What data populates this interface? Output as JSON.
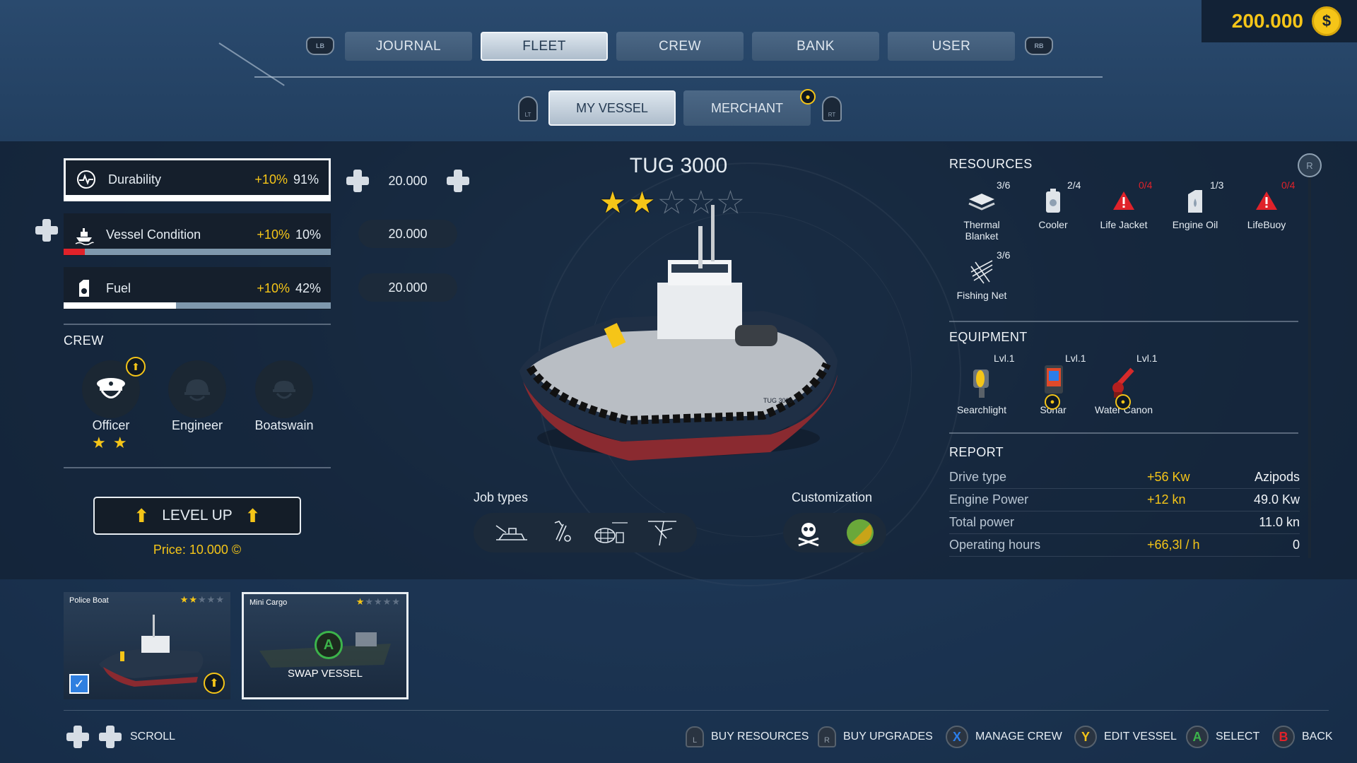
{
  "currency": {
    "value": "200.000",
    "symbol": "$"
  },
  "tabs": [
    {
      "label": "JOURNAL",
      "active": false
    },
    {
      "label": "FLEET",
      "active": true
    },
    {
      "label": "CREW",
      "active": false
    },
    {
      "label": "BANK",
      "active": false
    },
    {
      "label": "USER",
      "active": false
    }
  ],
  "bumpers": {
    "left": "LB",
    "right": "RB"
  },
  "subtabs": [
    {
      "label": "MY VESSEL",
      "active": true
    },
    {
      "label": "MERCHANT",
      "active": false,
      "notification": true
    }
  ],
  "triggers": {
    "left": "LT",
    "right": "RT"
  },
  "stats": [
    {
      "label": "Durability",
      "bonus": "+10%",
      "value": "91%",
      "level": 1.0,
      "cost": "20.000",
      "icon": "durability-icon"
    },
    {
      "label": "Vessel Condition",
      "bonus": "+10%",
      "value": "10%",
      "level": 0.08,
      "cost": "20.000",
      "icon": "vessel-condition-icon"
    },
    {
      "label": "Fuel",
      "bonus": "+10%",
      "value": "42%",
      "level": 0.42,
      "cost": "20.000",
      "icon": "fuel-icon"
    }
  ],
  "crew": {
    "title": "CREW",
    "members": [
      {
        "name": "Officer",
        "stars": "★ ★",
        "upgrade": true
      },
      {
        "name": "Engineer"
      },
      {
        "name": "Boatswain"
      }
    ],
    "level_up_label": "LEVEL UP",
    "price": "Price: 10.000",
    "price_icon": "coin-icon"
  },
  "vessel": {
    "name": "TUG 3000",
    "stars_total": 5,
    "stars_filled": 2,
    "hull_label": "TUG 3000",
    "job_types_label": "Job types",
    "job_types": [
      "towing-icon",
      "diving-icon",
      "fishing-net-icon",
      "rescue-icon"
    ],
    "customization_label": "Customization"
  },
  "resources": {
    "title": "RESOURCES",
    "items": [
      {
        "name": "Thermal Blanket",
        "count": "3/6",
        "alert": false
      },
      {
        "name": "Cooler",
        "count": "2/4",
        "alert": false
      },
      {
        "name": "Life Jacket",
        "count": "0/4",
        "alert": true
      },
      {
        "name": "Engine Oil",
        "count": "1/3",
        "alert": false
      },
      {
        "name": "LifeBuoy",
        "count": "0/4",
        "alert": true
      },
      {
        "name": "Fishing Net",
        "count": "3/6",
        "alert": false
      }
    ]
  },
  "equipment": {
    "title": "EQUIPMENT",
    "items": [
      {
        "name": "Searchlight",
        "level": "Lvl.1"
      },
      {
        "name": "Sonar",
        "level": "Lvl.1"
      },
      {
        "name": "Water Canon",
        "level": "Lvl.1"
      }
    ]
  },
  "report": {
    "title": "REPORT",
    "rows": [
      {
        "label": "Drive type",
        "bonus": "+56 Kw",
        "value": "Azipods"
      },
      {
        "label": "Engine Power",
        "bonus": "+12 kn",
        "value": "49.0 Kw"
      },
      {
        "label": "Total power",
        "bonus": "",
        "value": "11.0 kn"
      },
      {
        "label": "Operating hours",
        "bonus": "+66,3l / h",
        "value": "0"
      }
    ]
  },
  "scroll_button": "R",
  "vessel_cards": [
    {
      "name": "Police Boat",
      "stars_filled": 2,
      "stars_total": 5,
      "selected": false,
      "checked": true
    },
    {
      "name": "Mini Cargo",
      "stars_filled": 1,
      "stars_total": 5,
      "selected": true,
      "action_button": "A",
      "action_label": "SWAP VESSEL"
    }
  ],
  "hints": {
    "scroll": "SCROLL",
    "buy_resources": {
      "button": "L",
      "label": "BUY RESOURCES"
    },
    "buy_upgrades": {
      "button": "R",
      "label": "BUY UPGRADES"
    },
    "manage_crew": {
      "button": "X",
      "label": "MANAGE CREW"
    },
    "edit_vessel": {
      "button": "Y",
      "label": "EDIT VESSEL"
    },
    "select": {
      "button": "A",
      "label": "SELECT"
    },
    "back": {
      "button": "B",
      "label": "BACK"
    }
  },
  "colors": {
    "accent": "#f5c518",
    "alert": "#e0222a",
    "panel": "#151f2c"
  }
}
